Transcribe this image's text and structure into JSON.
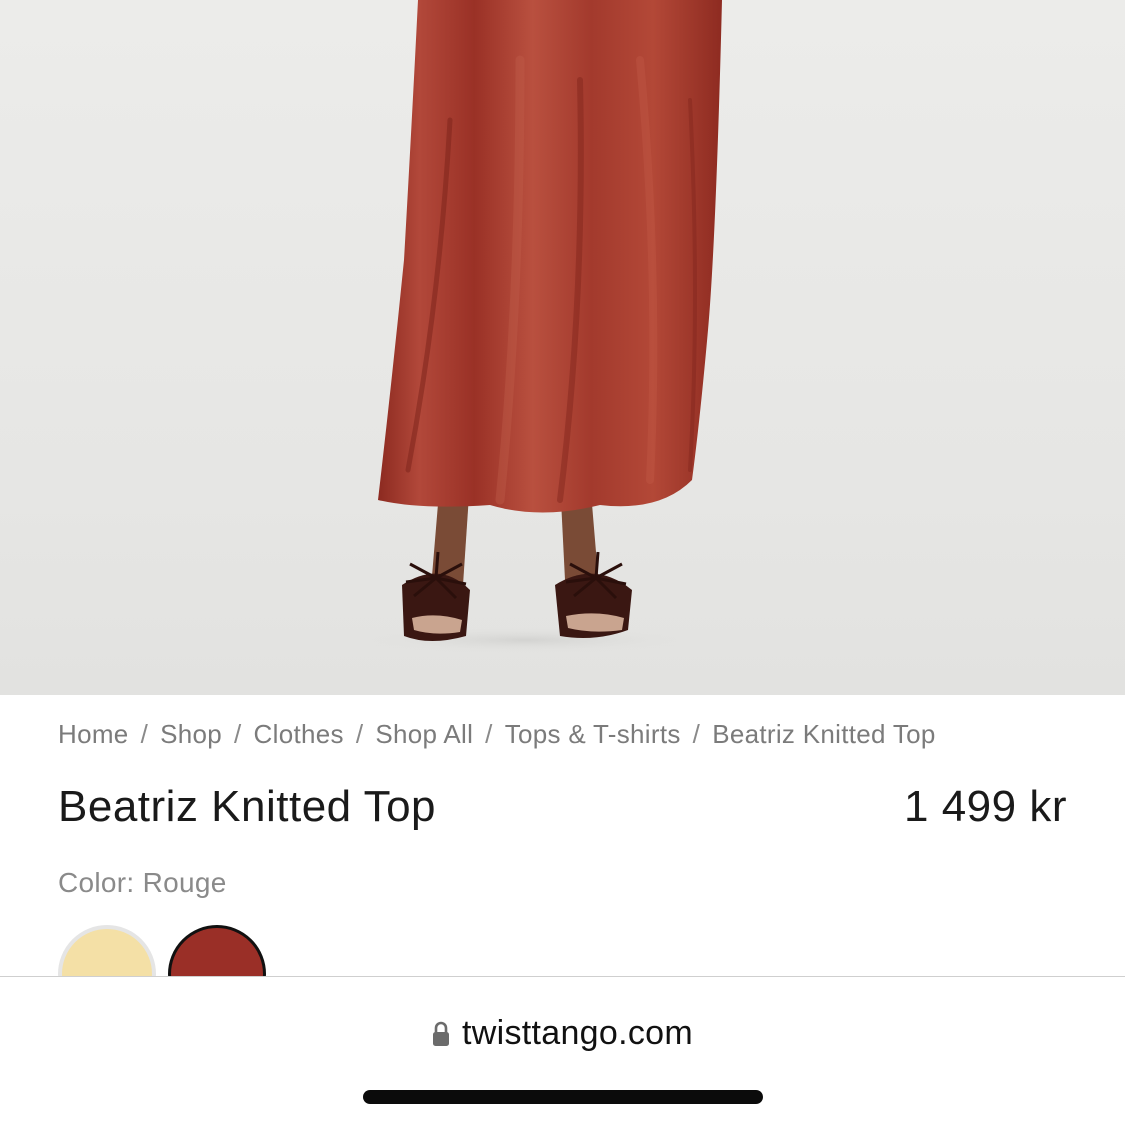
{
  "product_image": {
    "icon": "dress-photo",
    "dress_color": "#a2392c",
    "background": "#e8e8e6"
  },
  "breadcrumb": {
    "items": [
      {
        "label": "Home"
      },
      {
        "label": "Shop"
      },
      {
        "label": "Clothes"
      },
      {
        "label": "Shop All"
      },
      {
        "label": "Tops & T-shirts"
      },
      {
        "label": "Beatriz Knitted Top"
      }
    ],
    "separator": "/"
  },
  "product": {
    "title": "Beatriz Knitted Top",
    "price": "1 499 kr",
    "color_label": "Color: Rouge",
    "swatches": [
      {
        "name": "Yellow",
        "hex": "#f4e0a6"
      },
      {
        "name": "Rouge",
        "hex": "#9a2f27",
        "selected": true
      }
    ]
  },
  "browser": {
    "url": "twisttango.com",
    "icon": "lock-icon"
  }
}
